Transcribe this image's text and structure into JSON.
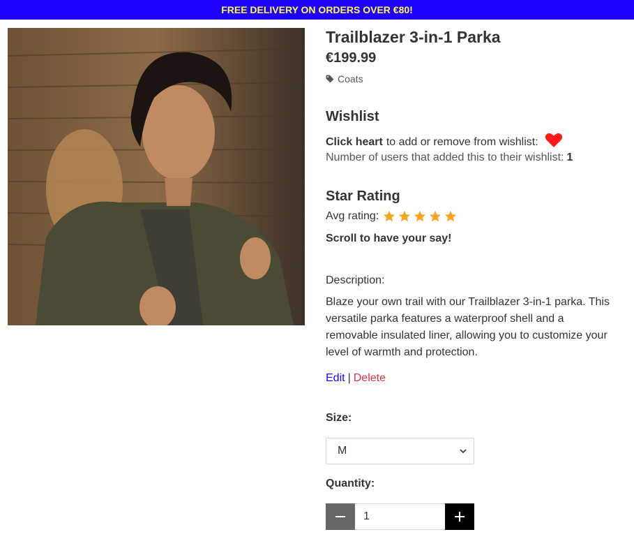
{
  "banner": {
    "text": "FREE DELIVERY ON ORDERS OVER €80!"
  },
  "product": {
    "name": "Trailblazer 3-in-1 Parka",
    "price": "€199.99",
    "category": "Coats"
  },
  "wishlist": {
    "title": "Wishlist",
    "prompt_bold": "Click heart",
    "prompt_rest": "to add or remove from wishlist:",
    "count_label": "Number of users that added this to their wishlist:",
    "count": "1"
  },
  "rating": {
    "title": "Star Rating",
    "avg_label": "Avg rating:",
    "stars": 5,
    "scroll_note": "Scroll to have your say!"
  },
  "description": {
    "label": "Description:",
    "text": "Blaze your own trail with our Trailblazer 3-in-1 parka. This versatile parka features a waterproof shell and a removable insulated liner, allowing you to customize your level of warmth and protection."
  },
  "admin": {
    "edit_label": "Edit",
    "separator": "|",
    "delete_label": "Delete"
  },
  "size": {
    "label": "Size:",
    "selected": "M"
  },
  "quantity": {
    "label": "Quantity:",
    "value": "1",
    "minus_icon": "minus-icon",
    "plus_icon": "plus-icon"
  },
  "colors": {
    "banner_bg": "#1e00ff",
    "banner_text": "#fff94a",
    "heart": "#ff1a1a",
    "star": "#f5a623",
    "edit_link": "#1e00ff",
    "delete_link": "#dc3545"
  }
}
